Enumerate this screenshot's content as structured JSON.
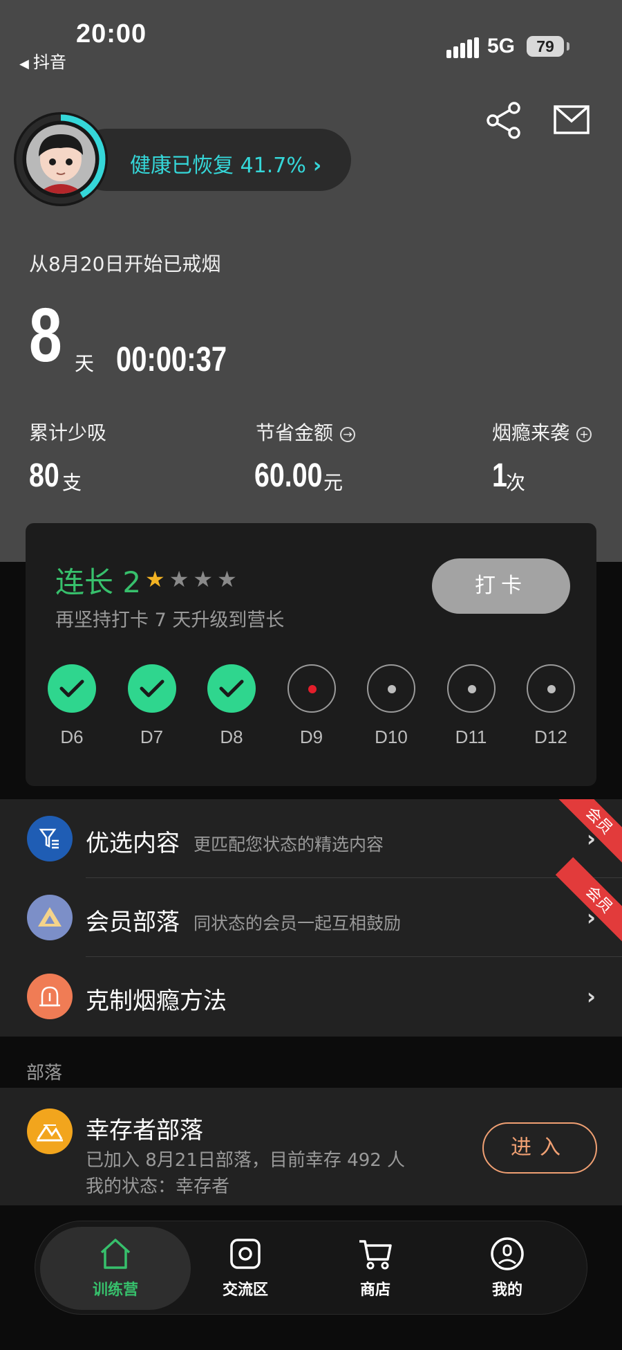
{
  "status_bar": {
    "time": "20:00",
    "back_app": "抖音",
    "network": "5G",
    "battery": "79"
  },
  "header": {
    "share_icon": "share-icon",
    "mail_icon": "mail-icon"
  },
  "health": {
    "label": "健康已恢复 41.7%",
    "chevron": "›",
    "progress": 0.417,
    "ring_color": "#35d7d9"
  },
  "quit": {
    "since": "从8月20日开始已戒烟",
    "days": "8",
    "days_unit": "天",
    "timer": "00:00:37"
  },
  "stats": [
    {
      "label": "累计少吸",
      "value": "80",
      "unit": "支",
      "icon": ""
    },
    {
      "label": "节省金额",
      "value": "60.00",
      "unit": "元",
      "icon": "arrow-right-circle-icon"
    },
    {
      "label": "烟瘾来袭",
      "value": "1",
      "unit": "次",
      "icon": "plus-circle-icon"
    }
  ],
  "level": {
    "title": "连长 2",
    "stars_on": 1,
    "stars_total": 4,
    "subtitle": "再坚持打卡 7 天升级到营长",
    "checkin_button": "打卡",
    "days": [
      {
        "label": "D6",
        "state": "done"
      },
      {
        "label": "D7",
        "state": "done"
      },
      {
        "label": "D8",
        "state": "done"
      },
      {
        "label": "D9",
        "state": "today"
      },
      {
        "label": "D10",
        "state": "future"
      },
      {
        "label": "D11",
        "state": "future"
      },
      {
        "label": "D12",
        "state": "future"
      }
    ],
    "accent": "#37c06c"
  },
  "menu": [
    {
      "title": "优选内容",
      "subtitle": "更匹配您状态的精选内容",
      "badge": "会员",
      "icon": "filter-list-icon",
      "icon_bg": "#1f5db4"
    },
    {
      "title": "会员部落",
      "subtitle": "同状态的会员一起互相鼓励",
      "badge": "会员",
      "icon": "triangle-icon",
      "icon_bg": "#7c8fc8"
    },
    {
      "title": "克制烟瘾方法",
      "subtitle": "",
      "badge": "",
      "icon": "alarm-light-icon",
      "icon_bg": "#f07c55"
    }
  ],
  "section": {
    "label": "部落"
  },
  "tribe": {
    "title": "幸存者部落",
    "line1": "已加入 8月21日部落，目前幸存 492 人",
    "line2": "我的状态：幸存者",
    "enter_button": "进入",
    "icon": "mountain-icon"
  },
  "tabs": [
    {
      "label": "训练营",
      "icon": "home-icon",
      "active": true
    },
    {
      "label": "交流区",
      "icon": "camera-square-icon",
      "active": false
    },
    {
      "label": "商店",
      "icon": "cart-icon",
      "active": false
    },
    {
      "label": "我的",
      "icon": "user-circle-icon",
      "active": false
    }
  ]
}
